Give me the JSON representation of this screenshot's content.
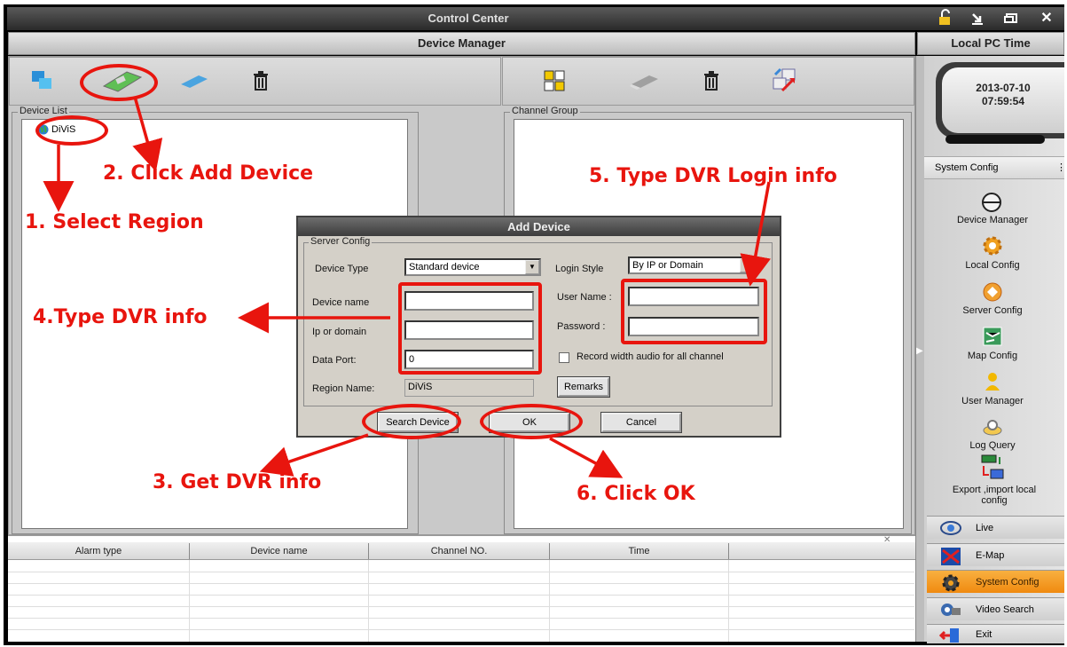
{
  "window": {
    "title": "Control Center"
  },
  "header": {
    "device_manager": "Device Manager",
    "local_pc_time": "Local PC Time"
  },
  "device_list": {
    "label": "Device List",
    "region": "DiViS"
  },
  "channel_group": {
    "label": "Channel Group"
  },
  "clock": {
    "date": "2013-07-10",
    "time": "07:59:54"
  },
  "sidebar": {
    "section": "System Config",
    "items": [
      {
        "label": "Device Manager",
        "icon": "camera-dome-icon"
      },
      {
        "label": "Local Config",
        "icon": "gear-icon"
      },
      {
        "label": "Server Config",
        "icon": "server-icon"
      },
      {
        "label": "Map Config",
        "icon": "map-icon"
      },
      {
        "label": "User Manager",
        "icon": "user-icon"
      },
      {
        "label": "Log Query",
        "icon": "log-icon"
      },
      {
        "label": "Export ,import local config",
        "icon": "export-icon"
      }
    ]
  },
  "nav": [
    {
      "label": "Live",
      "icon": "eye-icon"
    },
    {
      "label": "E-Map",
      "icon": "emap-icon"
    },
    {
      "label": "System Config",
      "icon": "gear-icon",
      "active": true
    },
    {
      "label": "Video Search",
      "icon": "film-icon"
    },
    {
      "label": "Exit",
      "icon": "exit-icon"
    }
  ],
  "alarm_table": {
    "columns": [
      "Alarm type",
      "Device name",
      "Channel NO.",
      "Time"
    ]
  },
  "dialog": {
    "title": "Add Device",
    "group": "Server Config",
    "device_type_label": "Device Type",
    "device_type_value": "Standard device",
    "login_style_label": "Login Style",
    "login_style_value": "By IP or Domain",
    "device_name_label": "Device name",
    "ip_label": "Ip or domain",
    "port_label": "Data Port:",
    "port_value": "0",
    "region_label": "Region Name:",
    "region_value": "DiViS",
    "username_label": "User Name :",
    "password_label": "Password :",
    "record_audio_label": "Record width audio for all channel",
    "remarks_button": "Remarks",
    "search_button": "Search Device",
    "ok_button": "OK",
    "cancel_button": "Cancel"
  },
  "annotations": {
    "step1": "1. Select Region",
    "step2": "2. Click Add Device",
    "step3": "3. Get DVR info",
    "step4": "4.Type DVR info",
    "step5": "5. Type DVR Login info",
    "step6": "6. Click OK",
    "color": "#e8150e"
  }
}
